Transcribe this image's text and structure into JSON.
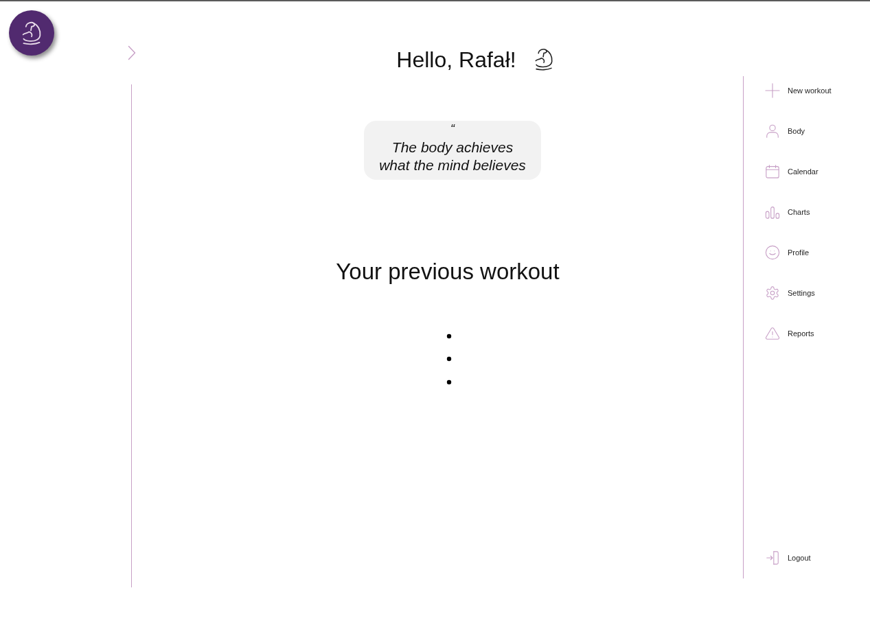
{
  "header": {
    "greeting": "Hello, Rafał!"
  },
  "quote": {
    "mark": "“",
    "text": "The body achieves\nwhat the mind believes"
  },
  "section": {
    "title": "Your previous workout"
  },
  "sidebar": {
    "items": [
      {
        "label": "New workout"
      },
      {
        "label": "Body"
      },
      {
        "label": "Calendar"
      },
      {
        "label": "Charts"
      },
      {
        "label": "Profile"
      },
      {
        "label": "Settings"
      },
      {
        "label": "Reports"
      }
    ],
    "footer_item": {
      "label": "Logout"
    }
  }
}
